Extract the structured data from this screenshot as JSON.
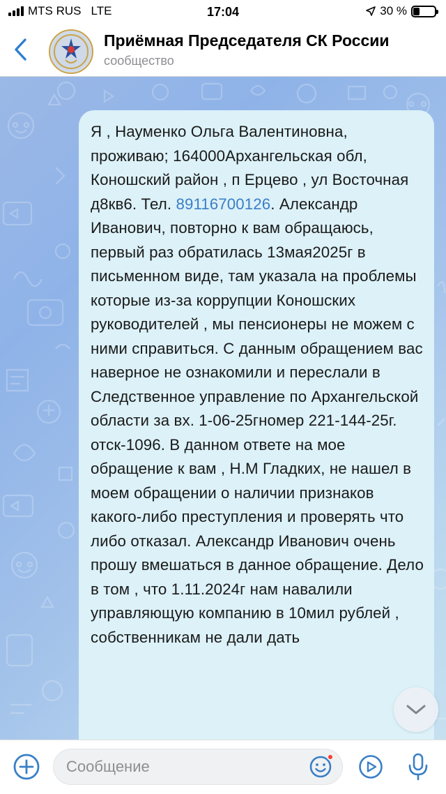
{
  "status_bar": {
    "carrier": "MTS RUS",
    "network": "LTE",
    "time": "17:04",
    "battery_percent": "30 %",
    "battery_level": 0.3
  },
  "header": {
    "back_icon": "chevron-left-icon",
    "avatar_icon": "sk-emblem-icon",
    "title": "Приёмная Председателя СК России",
    "subtitle": "сообщество"
  },
  "chat": {
    "message": {
      "text_before_phone": "Я , Науменко Ольга Валентиновна, проживаю; 164000Архангельская обл, Коношский район , п Ерцево , ул Восточная д8кв6. Тел. ",
      "phone": "89116700126",
      "text_after_phone": ". Александр Иванович, повторно к вам обращаюсь, первый раз обратилась 13мая2025г в письменном виде, там указала на проблемы которые из-за коррупции Коношских руководителей , мы пенсионеры не можем с ними справиться. С данным обращением вас наверное не ознакомили и переслали в Следственное управление по Архангельской области за вх. 1-06-25гномер 221-144-25г. отск-1096. В данном ответе на мое обращение к вам , Н.М Гладких, не нашел в моем обращении о наличии признаков какого-либо преступления и проверять что либо отказал.  Александр Иванович очень прошу вмешаться в данное обращение. Дело в том , что 1.11.2024г нам навалили управляющую компанию в 10мил рублей , собственникам не дали дать"
    },
    "scroll_down_icon": "chevron-down-icon"
  },
  "input_bar": {
    "attach_icon": "plus-circle-icon",
    "placeholder": "Сообщение",
    "sticker_icon": "smile-icon",
    "video_icon": "play-circle-icon",
    "mic_icon": "microphone-icon"
  },
  "colors": {
    "accent": "#3a7fc6",
    "bubble": "#dcf1f8",
    "chat_bg_start": "#9bb8e6",
    "chat_bg_end": "#c6e0f0"
  }
}
